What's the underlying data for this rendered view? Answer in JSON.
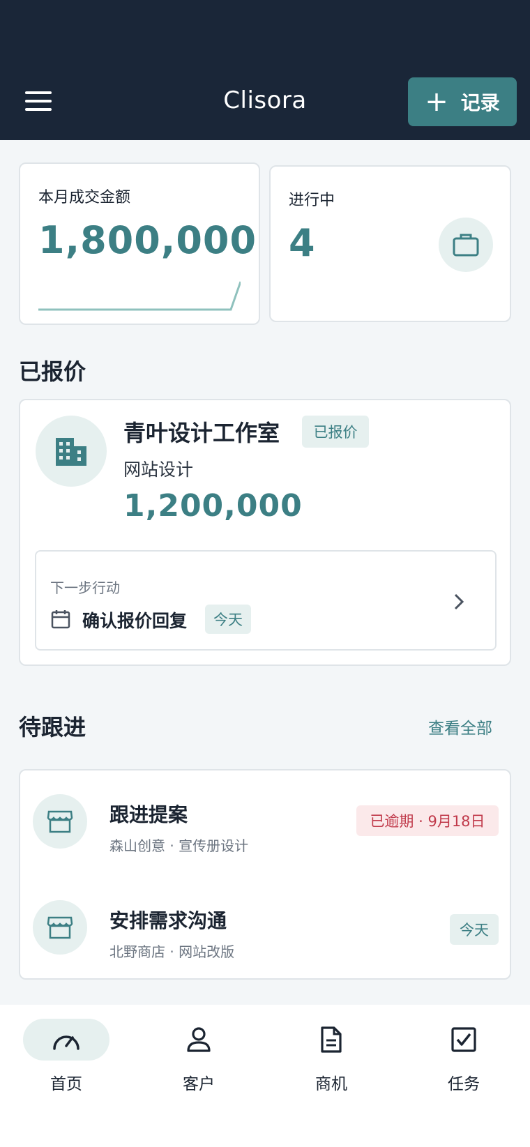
{
  "header": {
    "title": "Clisora",
    "record_button": "记录"
  },
  "stats": {
    "monthly_amount": {
      "label": "本月成交金额",
      "value": "1,800,000"
    },
    "in_progress": {
      "label": "进行中",
      "value": "4"
    }
  },
  "quoted": {
    "section_title": "已报价",
    "item": {
      "company": "青叶设计工作室",
      "status": "已报价",
      "project": "网站设计",
      "amount": "1,200,000",
      "next_label": "下一步行动",
      "next_action": "确认报价回复",
      "next_due": "今天"
    }
  },
  "followups": {
    "section_title": "待跟进",
    "view_all": "查看全部",
    "items": [
      {
        "title": "跟进提案",
        "subtitle": "森山创意 · 宣传册设计",
        "badge": "已逾期 · 9月18日",
        "badge_type": "overdue"
      },
      {
        "title": "安排需求沟通",
        "subtitle": "北野商店 · 网站改版",
        "badge": "今天",
        "badge_type": "today"
      }
    ]
  },
  "nav": {
    "items": [
      {
        "label": "首页",
        "icon": "dashboard-icon",
        "active": true
      },
      {
        "label": "客户",
        "icon": "person-icon",
        "active": false
      },
      {
        "label": "商机",
        "icon": "document-icon",
        "active": false
      },
      {
        "label": "任务",
        "icon": "checkbox-icon",
        "active": false
      }
    ]
  },
  "colors": {
    "header_bg": "#1a2638",
    "accent": "#3c7f84",
    "overdue": "#c0394a"
  }
}
